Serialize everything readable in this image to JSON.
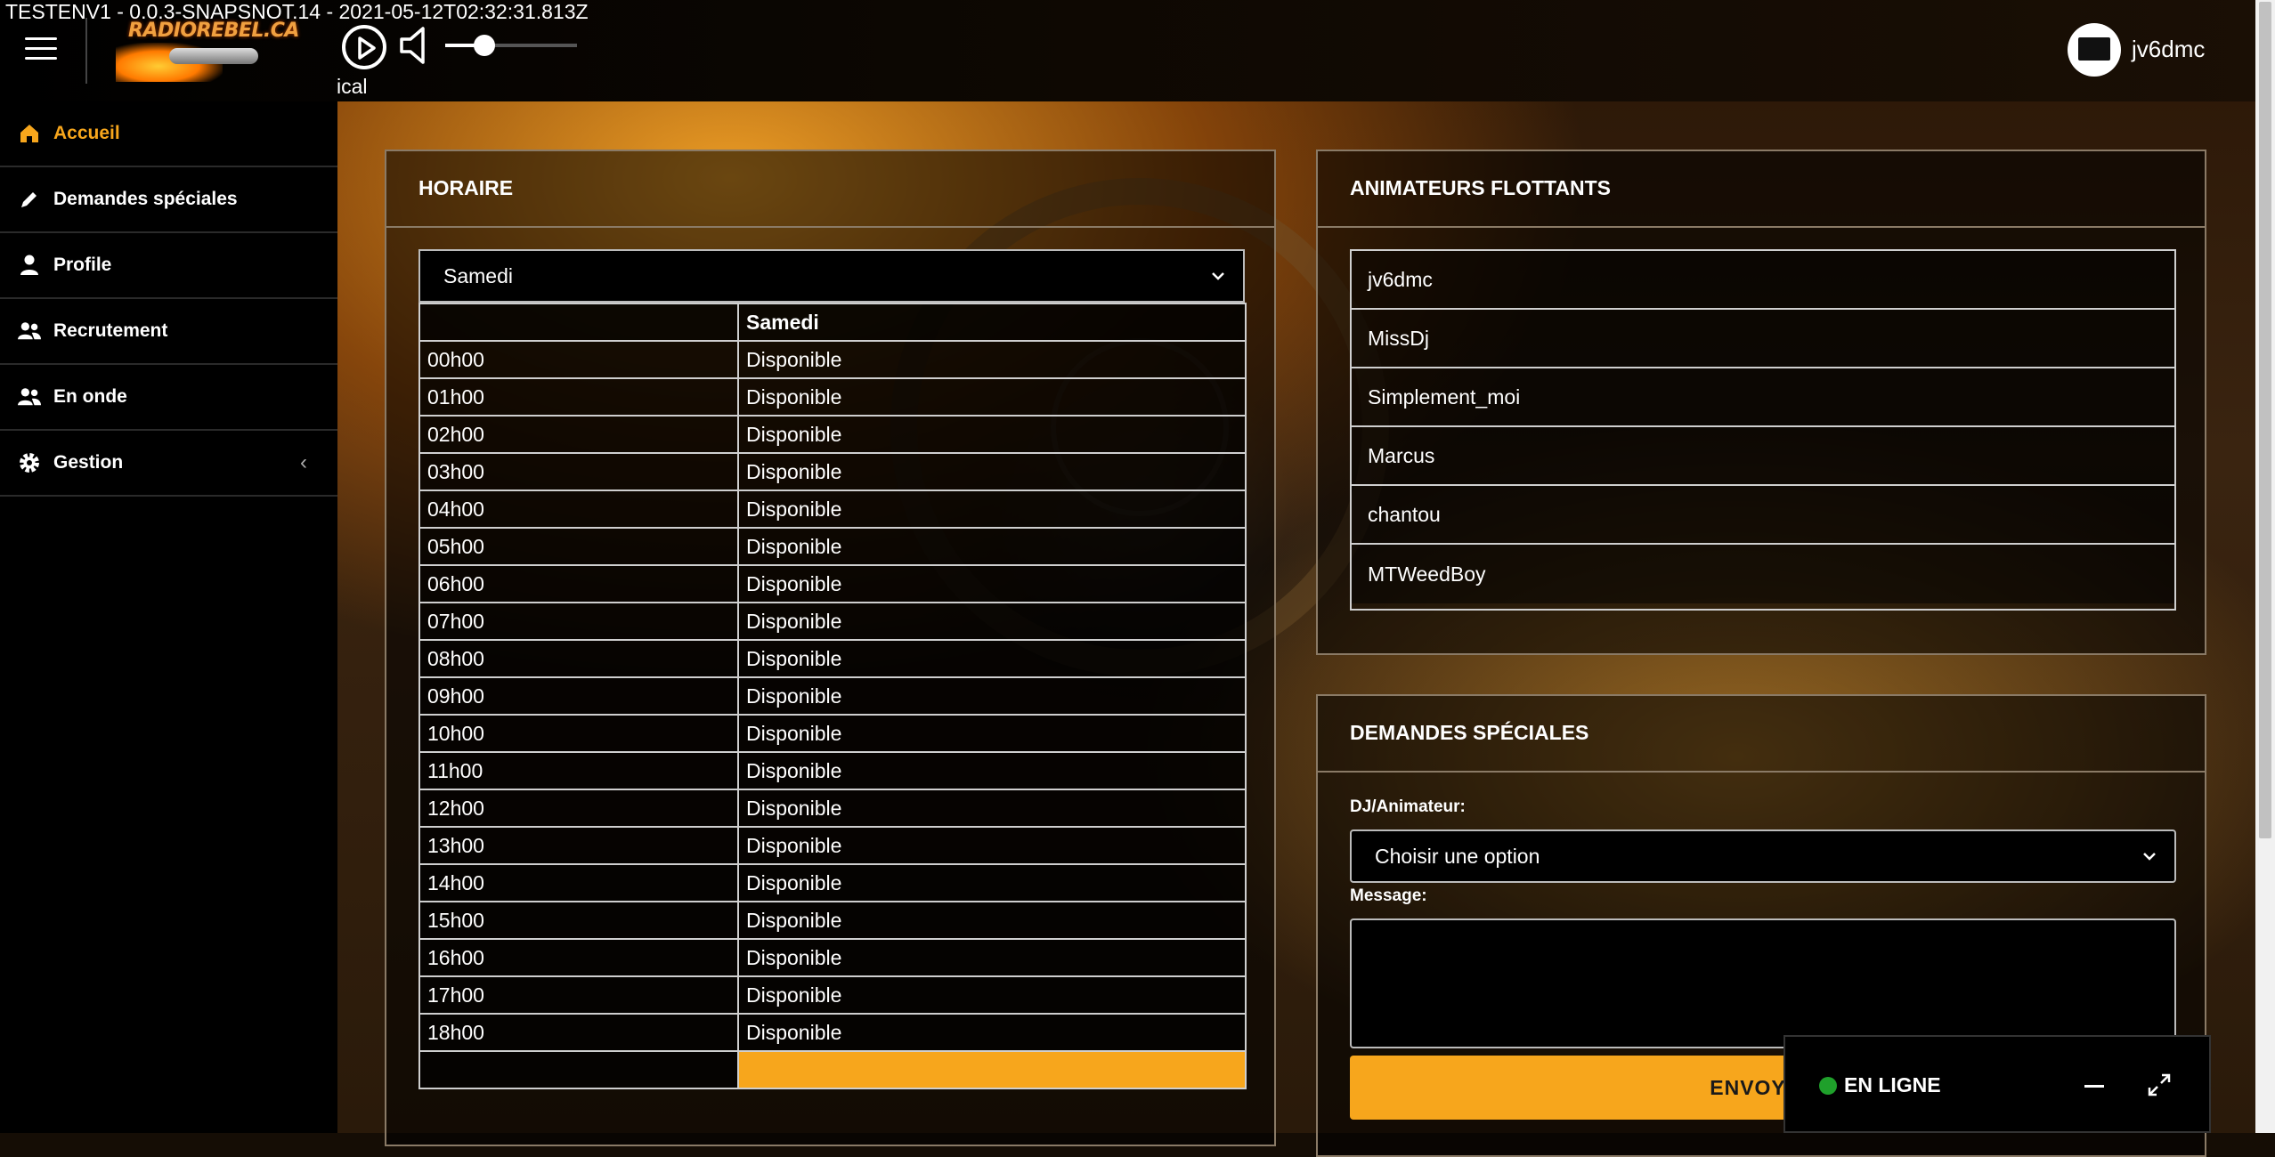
{
  "build_info": "TESTENV1 - 0.0.3-SNAPSNOT.14 - 2021-05-12T02:32:31.813Z",
  "header": {
    "logo_text": "RADIOREBEL.CA",
    "player_caption": "ical",
    "volume_level": 0.3,
    "username": "jv6dmc",
    "icons": [
      "menu-icon",
      "play-icon",
      "volume-icon",
      "avatar"
    ]
  },
  "sidebar": {
    "items": [
      {
        "label": "Accueil",
        "icon": "home-icon",
        "active": true
      },
      {
        "label": "Demandes spéciales",
        "icon": "pencil-icon",
        "active": false
      },
      {
        "label": "Profile",
        "icon": "user-icon",
        "active": false
      },
      {
        "label": "Recrutement",
        "icon": "users-icon",
        "active": false
      },
      {
        "label": "En onde",
        "icon": "users-icon",
        "active": false
      },
      {
        "label": "Gestion",
        "icon": "gear-icon",
        "active": false,
        "chevron": "‹"
      }
    ]
  },
  "schedule": {
    "title": "HORAIRE",
    "selected_day": "Samedi",
    "column_header": "Samedi",
    "rows": [
      {
        "time": "00h00",
        "status": "Disponible"
      },
      {
        "time": "01h00",
        "status": "Disponible"
      },
      {
        "time": "02h00",
        "status": "Disponible"
      },
      {
        "time": "03h00",
        "status": "Disponible"
      },
      {
        "time": "04h00",
        "status": "Disponible"
      },
      {
        "time": "05h00",
        "status": "Disponible"
      },
      {
        "time": "06h00",
        "status": "Disponible"
      },
      {
        "time": "07h00",
        "status": "Disponible"
      },
      {
        "time": "08h00",
        "status": "Disponible"
      },
      {
        "time": "09h00",
        "status": "Disponible"
      },
      {
        "time": "10h00",
        "status": "Disponible"
      },
      {
        "time": "11h00",
        "status": "Disponible"
      },
      {
        "time": "12h00",
        "status": "Disponible"
      },
      {
        "time": "13h00",
        "status": "Disponible"
      },
      {
        "time": "14h00",
        "status": "Disponible"
      },
      {
        "time": "15h00",
        "status": "Disponible"
      },
      {
        "time": "16h00",
        "status": "Disponible"
      },
      {
        "time": "17h00",
        "status": "Disponible"
      },
      {
        "time": "18h00",
        "status": "Disponible"
      },
      {
        "time": "",
        "status": ""
      }
    ]
  },
  "floating_hosts": {
    "title": "ANIMATEURS FLOTTANTS",
    "items": [
      "jv6dmc",
      "MissDj",
      "Simplement_moi",
      "Marcus",
      "chantou",
      "MTWeedBoy"
    ]
  },
  "special_requests": {
    "title": "DEMANDES SPÉCIALES",
    "dj_label": "DJ/Animateur:",
    "dj_select_value": "Choisir une option",
    "message_label": "Message:",
    "message_value": "",
    "send_label": "ENVOYER"
  },
  "chat": {
    "status_label": "EN LIGNE",
    "status_color": "#1fa02b"
  },
  "colors": {
    "accent": "#f7a61c",
    "sidebar_bg": "#000000"
  }
}
